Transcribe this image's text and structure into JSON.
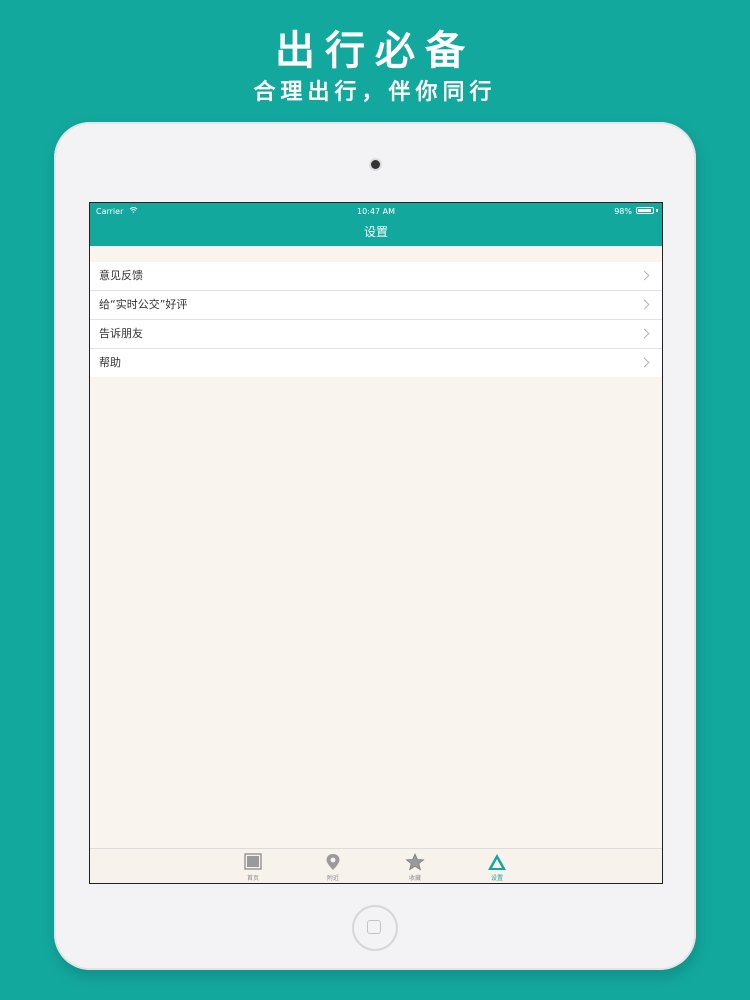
{
  "promo": {
    "title": "出行必备",
    "subtitle": "合理出行，伴你同行"
  },
  "colors": {
    "brand": "#13a89e",
    "screen_bg": "#faf4ee",
    "text": "#333333",
    "tab_inactive": "#8c8c8c"
  },
  "statusbar": {
    "carrier": "Carrier",
    "time": "10:47 AM",
    "battery": "98%"
  },
  "navbar": {
    "title": "设置"
  },
  "settings": {
    "items": [
      {
        "label": "意见反馈",
        "icon": "chevron-right-icon"
      },
      {
        "label": "给“实时公交”好评",
        "icon": "chevron-right-icon"
      },
      {
        "label": "告诉朋友",
        "icon": "chevron-right-icon"
      },
      {
        "label": "帮助",
        "icon": "chevron-right-icon"
      }
    ]
  },
  "tabbar": {
    "tabs": [
      {
        "label": "首页",
        "icon": "home-square-icon",
        "active": false
      },
      {
        "label": "附近",
        "icon": "location-pin-icon",
        "active": false
      },
      {
        "label": "收藏",
        "icon": "star-icon",
        "active": false
      },
      {
        "label": "设置",
        "icon": "triangle-settings-icon",
        "active": true
      }
    ]
  }
}
